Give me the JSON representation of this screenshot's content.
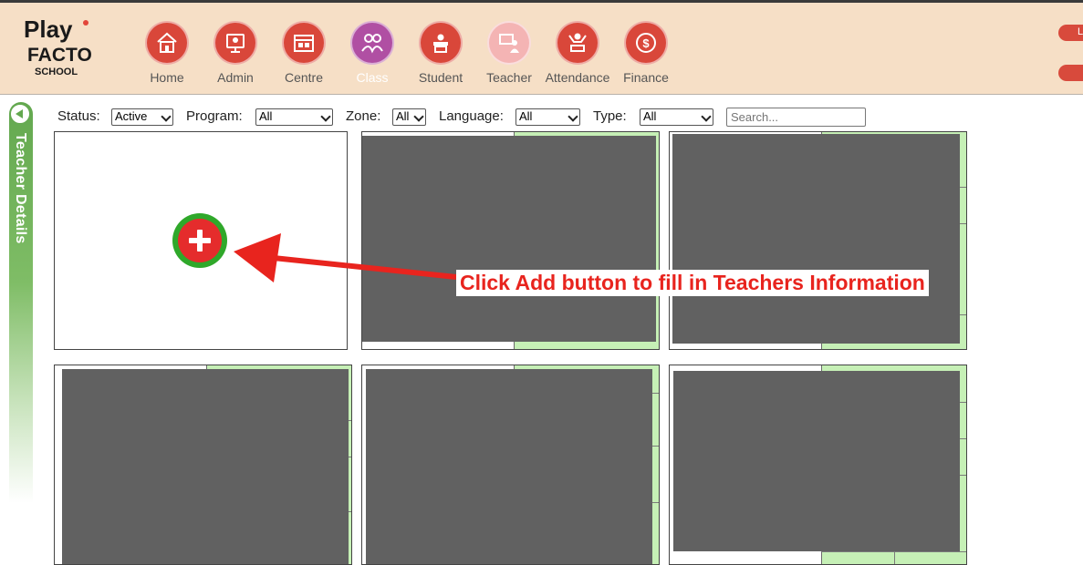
{
  "logo": {
    "line1": "Play",
    "line2": "FACTO",
    "line3": "SCHOOL"
  },
  "nav": [
    {
      "label": "Home",
      "icon": "home-icon",
      "color": "#d9473a",
      "active": false
    },
    {
      "label": "Admin",
      "icon": "admin-icon",
      "color": "#d9473a",
      "active": false
    },
    {
      "label": "Centre",
      "icon": "centre-icon",
      "color": "#d9473a",
      "active": false
    },
    {
      "label": "Class",
      "icon": "class-icon",
      "color": "#b04fa3",
      "active": true
    },
    {
      "label": "Student",
      "icon": "student-icon",
      "color": "#d9473a",
      "active": false
    },
    {
      "label": "Teacher",
      "icon": "teacher-icon",
      "color": "#f4b4b4",
      "active": false
    },
    {
      "label": "Attendance",
      "icon": "attendance-icon",
      "color": "#d9473a",
      "active": false
    },
    {
      "label": "Finance",
      "icon": "finance-icon",
      "color": "#d9473a",
      "active": false
    }
  ],
  "right_controls": {
    "top_label": "L"
  },
  "sidebar": {
    "label": "Teacher Details"
  },
  "filters": {
    "status_label": "Status:",
    "status_value": "Active",
    "program_label": "Program:",
    "program_value": "All",
    "zone_label": "Zone:",
    "zone_value": "All",
    "language_label": "Language:",
    "language_value": "All",
    "type_label": "Type:",
    "type_value": "All",
    "search_placeholder": "Search..."
  },
  "annotation": {
    "text": "Click Add button to fill in Teachers Information",
    "color": "#e8241e"
  },
  "colors": {
    "header_bg": "#f6dfc6",
    "accent_red": "#d9473a",
    "accent_green": "#63a84f",
    "card_green": "#c6f0b6"
  }
}
